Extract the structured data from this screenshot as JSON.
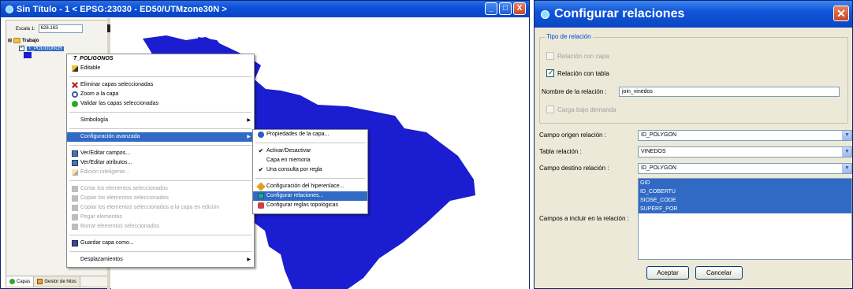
{
  "left_window": {
    "title": "Sin Título - 1 < EPSG:23030 - ED50/UTMzone30N >",
    "buttons": {
      "minimize": "_",
      "maximize": "□",
      "close": "X"
    },
    "scale_label": "Escala 1:",
    "scale_value": "628.163",
    "tree_root": "Trabajo",
    "layer_name": "T_POLIGONOS",
    "tabs": {
      "layers": "Capas",
      "catalog": "Gestor de hitos"
    }
  },
  "context_menu": {
    "header": "T_POLIGONOS",
    "items": [
      {
        "label": "Editable"
      },
      {
        "label": "Eliminar capas seleccionadas"
      },
      {
        "label": "Zoom a la capa"
      },
      {
        "label": "Validar las capas seleccionadas"
      },
      {
        "label": "Simbología"
      },
      {
        "label": "Configuración avanzada"
      },
      {
        "label": "Ver/Editar campos..."
      },
      {
        "label": "Ver/Editar atributos..."
      },
      {
        "label": "Edición inteligente..."
      },
      {
        "label": "Cortar los elementos seleccionados"
      },
      {
        "label": "Copiar los elementos seleccionados"
      },
      {
        "label": "Copiar los elementos seleccionados a la capa en edición"
      },
      {
        "label": "Pegar elementos"
      },
      {
        "label": "Borrar elementos seleccionados"
      },
      {
        "label": "Guardar capa como..."
      },
      {
        "label": "Desplazamientos"
      }
    ]
  },
  "submenu": {
    "items": [
      {
        "label": "Propiedades de la capa..."
      },
      {
        "label": "Activar/Desactivar"
      },
      {
        "label": "Capa en memoria"
      },
      {
        "label": "Una consulta por regla"
      },
      {
        "label": "Configuración del hiperenlace..."
      },
      {
        "label": "Configurar relaciones..."
      },
      {
        "label": "Configurar reglas topológicas"
      }
    ]
  },
  "dialog": {
    "title": "Configurar relaciones",
    "group_title": "Tipo de relación",
    "rel_capa": "Relación con capa",
    "rel_tabla": "Relación con tabla",
    "name_label": "Nombre de la relación :",
    "name_value": "join_vinedos",
    "carga_label": "Carga bajo demanda",
    "origen_label": "Campo origen relación :",
    "origen_value": "ID_POLYGON",
    "tabla_label": "Tabla relación :",
    "tabla_value": "VINEDOS",
    "destino_label": "Campo destino relación :",
    "destino_value": "ID_POLYGON",
    "incluir_label": "Campos a incluir en la relación :",
    "fields": [
      "GID",
      "ID_COBERTU",
      "SIOSE_CODE",
      "SUPERF_POR"
    ],
    "accept": "Aceptar",
    "cancel": "Cancelar"
  },
  "colors": {
    "map_fill": "#1b1dd0",
    "selection": "#316ac5",
    "title_blue": "#0b4fd6"
  }
}
